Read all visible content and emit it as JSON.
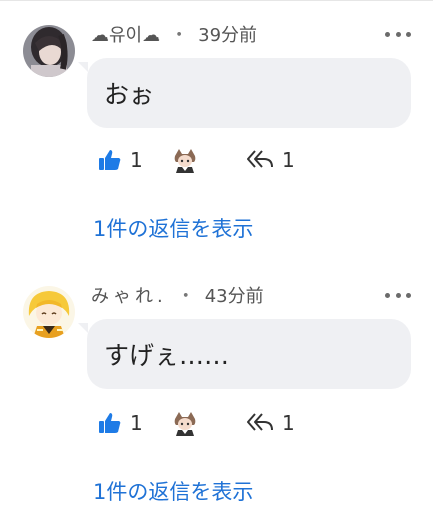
{
  "comments": [
    {
      "author": "☁유이☁",
      "time": "39分前",
      "text": "おぉ",
      "like_count": "1",
      "reply_count": "1",
      "view_replies": "1件の返信を表示"
    },
    {
      "author": "みゃれ.",
      "time": "43分前",
      "text": "すげぇ……",
      "like_count": "1",
      "reply_count": "1",
      "view_replies": "1件の返信を表示"
    }
  ],
  "separator": "・",
  "colors": {
    "accent": "#1f72d6",
    "bubble": "#eff0f3",
    "like_icon": "#1e7be6"
  },
  "icons": [
    "thumbs-up-icon",
    "creator-heart-avatar-icon",
    "reply-icon",
    "more-icon"
  ]
}
